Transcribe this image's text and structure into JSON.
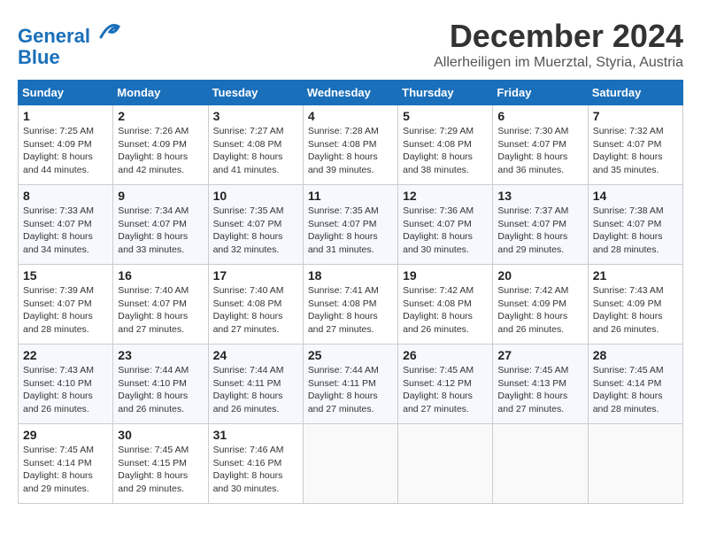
{
  "header": {
    "logo_line1": "General",
    "logo_line2": "Blue",
    "month": "December 2024",
    "location": "Allerheiligen im Muerztal, Styria, Austria"
  },
  "days_of_week": [
    "Sunday",
    "Monday",
    "Tuesday",
    "Wednesday",
    "Thursday",
    "Friday",
    "Saturday"
  ],
  "weeks": [
    [
      {
        "day": "1",
        "sunrise": "Sunrise: 7:25 AM",
        "sunset": "Sunset: 4:09 PM",
        "daylight": "Daylight: 8 hours and 44 minutes."
      },
      {
        "day": "2",
        "sunrise": "Sunrise: 7:26 AM",
        "sunset": "Sunset: 4:09 PM",
        "daylight": "Daylight: 8 hours and 42 minutes."
      },
      {
        "day": "3",
        "sunrise": "Sunrise: 7:27 AM",
        "sunset": "Sunset: 4:08 PM",
        "daylight": "Daylight: 8 hours and 41 minutes."
      },
      {
        "day": "4",
        "sunrise": "Sunrise: 7:28 AM",
        "sunset": "Sunset: 4:08 PM",
        "daylight": "Daylight: 8 hours and 39 minutes."
      },
      {
        "day": "5",
        "sunrise": "Sunrise: 7:29 AM",
        "sunset": "Sunset: 4:08 PM",
        "daylight": "Daylight: 8 hours and 38 minutes."
      },
      {
        "day": "6",
        "sunrise": "Sunrise: 7:30 AM",
        "sunset": "Sunset: 4:07 PM",
        "daylight": "Daylight: 8 hours and 36 minutes."
      },
      {
        "day": "7",
        "sunrise": "Sunrise: 7:32 AM",
        "sunset": "Sunset: 4:07 PM",
        "daylight": "Daylight: 8 hours and 35 minutes."
      }
    ],
    [
      {
        "day": "8",
        "sunrise": "Sunrise: 7:33 AM",
        "sunset": "Sunset: 4:07 PM",
        "daylight": "Daylight: 8 hours and 34 minutes."
      },
      {
        "day": "9",
        "sunrise": "Sunrise: 7:34 AM",
        "sunset": "Sunset: 4:07 PM",
        "daylight": "Daylight: 8 hours and 33 minutes."
      },
      {
        "day": "10",
        "sunrise": "Sunrise: 7:35 AM",
        "sunset": "Sunset: 4:07 PM",
        "daylight": "Daylight: 8 hours and 32 minutes."
      },
      {
        "day": "11",
        "sunrise": "Sunrise: 7:35 AM",
        "sunset": "Sunset: 4:07 PM",
        "daylight": "Daylight: 8 hours and 31 minutes."
      },
      {
        "day": "12",
        "sunrise": "Sunrise: 7:36 AM",
        "sunset": "Sunset: 4:07 PM",
        "daylight": "Daylight: 8 hours and 30 minutes."
      },
      {
        "day": "13",
        "sunrise": "Sunrise: 7:37 AM",
        "sunset": "Sunset: 4:07 PM",
        "daylight": "Daylight: 8 hours and 29 minutes."
      },
      {
        "day": "14",
        "sunrise": "Sunrise: 7:38 AM",
        "sunset": "Sunset: 4:07 PM",
        "daylight": "Daylight: 8 hours and 28 minutes."
      }
    ],
    [
      {
        "day": "15",
        "sunrise": "Sunrise: 7:39 AM",
        "sunset": "Sunset: 4:07 PM",
        "daylight": "Daylight: 8 hours and 28 minutes."
      },
      {
        "day": "16",
        "sunrise": "Sunrise: 7:40 AM",
        "sunset": "Sunset: 4:07 PM",
        "daylight": "Daylight: 8 hours and 27 minutes."
      },
      {
        "day": "17",
        "sunrise": "Sunrise: 7:40 AM",
        "sunset": "Sunset: 4:08 PM",
        "daylight": "Daylight: 8 hours and 27 minutes."
      },
      {
        "day": "18",
        "sunrise": "Sunrise: 7:41 AM",
        "sunset": "Sunset: 4:08 PM",
        "daylight": "Daylight: 8 hours and 27 minutes."
      },
      {
        "day": "19",
        "sunrise": "Sunrise: 7:42 AM",
        "sunset": "Sunset: 4:08 PM",
        "daylight": "Daylight: 8 hours and 26 minutes."
      },
      {
        "day": "20",
        "sunrise": "Sunrise: 7:42 AM",
        "sunset": "Sunset: 4:09 PM",
        "daylight": "Daylight: 8 hours and 26 minutes."
      },
      {
        "day": "21",
        "sunrise": "Sunrise: 7:43 AM",
        "sunset": "Sunset: 4:09 PM",
        "daylight": "Daylight: 8 hours and 26 minutes."
      }
    ],
    [
      {
        "day": "22",
        "sunrise": "Sunrise: 7:43 AM",
        "sunset": "Sunset: 4:10 PM",
        "daylight": "Daylight: 8 hours and 26 minutes."
      },
      {
        "day": "23",
        "sunrise": "Sunrise: 7:44 AM",
        "sunset": "Sunset: 4:10 PM",
        "daylight": "Daylight: 8 hours and 26 minutes."
      },
      {
        "day": "24",
        "sunrise": "Sunrise: 7:44 AM",
        "sunset": "Sunset: 4:11 PM",
        "daylight": "Daylight: 8 hours and 26 minutes."
      },
      {
        "day": "25",
        "sunrise": "Sunrise: 7:44 AM",
        "sunset": "Sunset: 4:11 PM",
        "daylight": "Daylight: 8 hours and 27 minutes."
      },
      {
        "day": "26",
        "sunrise": "Sunrise: 7:45 AM",
        "sunset": "Sunset: 4:12 PM",
        "daylight": "Daylight: 8 hours and 27 minutes."
      },
      {
        "day": "27",
        "sunrise": "Sunrise: 7:45 AM",
        "sunset": "Sunset: 4:13 PM",
        "daylight": "Daylight: 8 hours and 27 minutes."
      },
      {
        "day": "28",
        "sunrise": "Sunrise: 7:45 AM",
        "sunset": "Sunset: 4:14 PM",
        "daylight": "Daylight: 8 hours and 28 minutes."
      }
    ],
    [
      {
        "day": "29",
        "sunrise": "Sunrise: 7:45 AM",
        "sunset": "Sunset: 4:14 PM",
        "daylight": "Daylight: 8 hours and 29 minutes."
      },
      {
        "day": "30",
        "sunrise": "Sunrise: 7:45 AM",
        "sunset": "Sunset: 4:15 PM",
        "daylight": "Daylight: 8 hours and 29 minutes."
      },
      {
        "day": "31",
        "sunrise": "Sunrise: 7:46 AM",
        "sunset": "Sunset: 4:16 PM",
        "daylight": "Daylight: 8 hours and 30 minutes."
      },
      null,
      null,
      null,
      null
    ]
  ]
}
